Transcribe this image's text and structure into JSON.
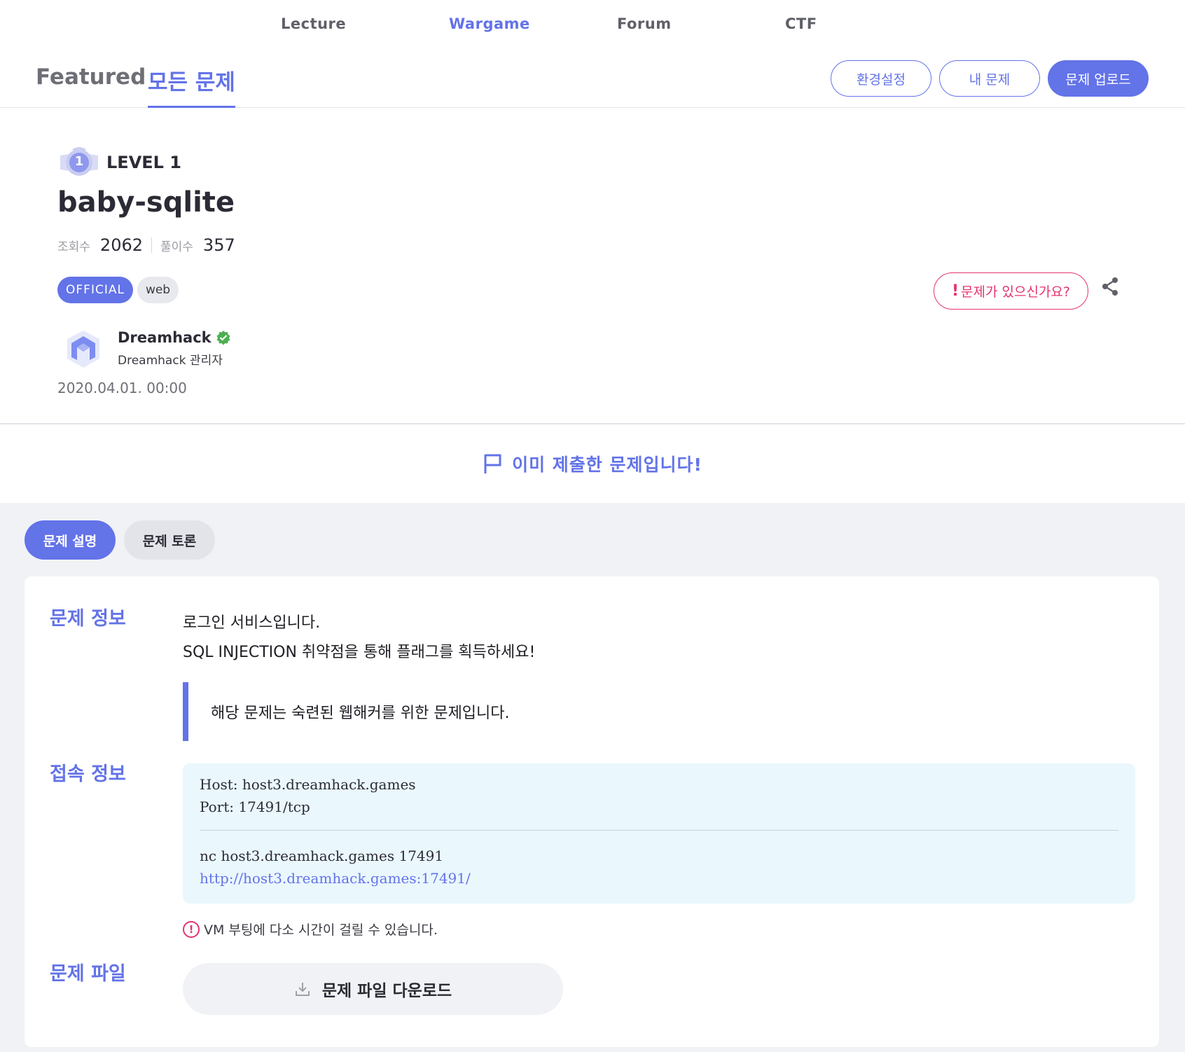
{
  "nav": {
    "items": [
      {
        "label": "Lecture"
      },
      {
        "label": "Wargame"
      },
      {
        "label": "Forum"
      },
      {
        "label": "CTF"
      }
    ],
    "active": "Wargame"
  },
  "subheader": {
    "tabs": [
      {
        "label": "Featured"
      },
      {
        "label": "모든 문제"
      }
    ],
    "buttons": {
      "settings": "환경설정",
      "my_problems": "내 문제",
      "upload": "문제 업로드"
    }
  },
  "challenge": {
    "level_badge_number": "1",
    "level": "LEVEL 1",
    "title": "baby-sqlite",
    "views_label": "조회수",
    "views": "2062",
    "solves_label": "풀이수",
    "solves": "357",
    "tags": [
      "OFFICIAL",
      "web"
    ],
    "report_label": "문제가 있으신가요?",
    "report_mark": "!",
    "author": {
      "name": "Dreamhack",
      "role": "Dreamhack 관리자"
    },
    "date": "2020.04.01. 00:00"
  },
  "submitted_banner": "이미 제출한 문제입니다!",
  "content_tabs": [
    {
      "label": "문제 설명"
    },
    {
      "label": "문제 토론"
    }
  ],
  "sections": {
    "info_label": "문제 정보",
    "description_lines": [
      "로그인 서비스입니다.",
      "SQL INJECTION 취약점을 통해 플래그를 획득하세요!"
    ],
    "quote": "해당 문제는 숙련된 웹해커를 위한 문제입니다.",
    "connection_label": "접속 정보",
    "connection": {
      "host": "Host: host3.dreamhack.games",
      "port": "Port: 17491/tcp",
      "nc": "nc host3.dreamhack.games 17491",
      "url": "http://host3.dreamhack.games:17491/"
    },
    "vm_note_mark": "!",
    "vm_note": "VM 부팅에 다소 시간이 걸릴 수 있습니다.",
    "file_label": "문제 파일",
    "download_label": "문제 파일 다운로드"
  },
  "colors": {
    "accent": "#6373e8",
    "danger": "#e3336f",
    "verified": "#4caf50",
    "conn_bg": "#eaf7fd"
  },
  "icons": [
    "level-badge-icon",
    "share-icon",
    "verified-icon",
    "flag-icon",
    "download-icon",
    "warning-icon",
    "dreamhack-logo"
  ]
}
